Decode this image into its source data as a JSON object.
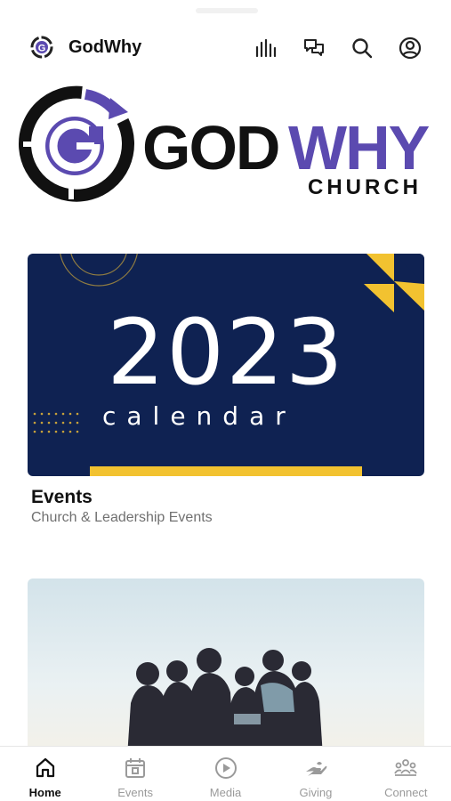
{
  "header": {
    "title": "GodWhy",
    "icons": [
      "livestream-bars-icon",
      "chat-bubbles-icon",
      "search-icon",
      "profile-icon"
    ]
  },
  "hero": {
    "wordmark_left": "GOD",
    "wordmark_right": "WHY",
    "subtitle": "CHURCH"
  },
  "cards": [
    {
      "image_year": "2023",
      "image_caption": "calendar",
      "title": "Events",
      "subtitle": "Church & Leadership Events"
    }
  ],
  "tabs": [
    {
      "label": "Home",
      "icon": "home-icon",
      "active": true
    },
    {
      "label": "Events",
      "icon": "calendar-icon",
      "active": false
    },
    {
      "label": "Media",
      "icon": "play-icon",
      "active": false
    },
    {
      "label": "Giving",
      "icon": "giving-hand-icon",
      "active": false
    },
    {
      "label": "Connect",
      "icon": "group-icon",
      "active": false
    }
  ],
  "colors": {
    "brand_purple": "#5b4ab0",
    "navy": "#0f2252",
    "accent_yellow": "#f2c230",
    "active_tab": "#111111",
    "inactive_tab": "#9a9a9a"
  }
}
